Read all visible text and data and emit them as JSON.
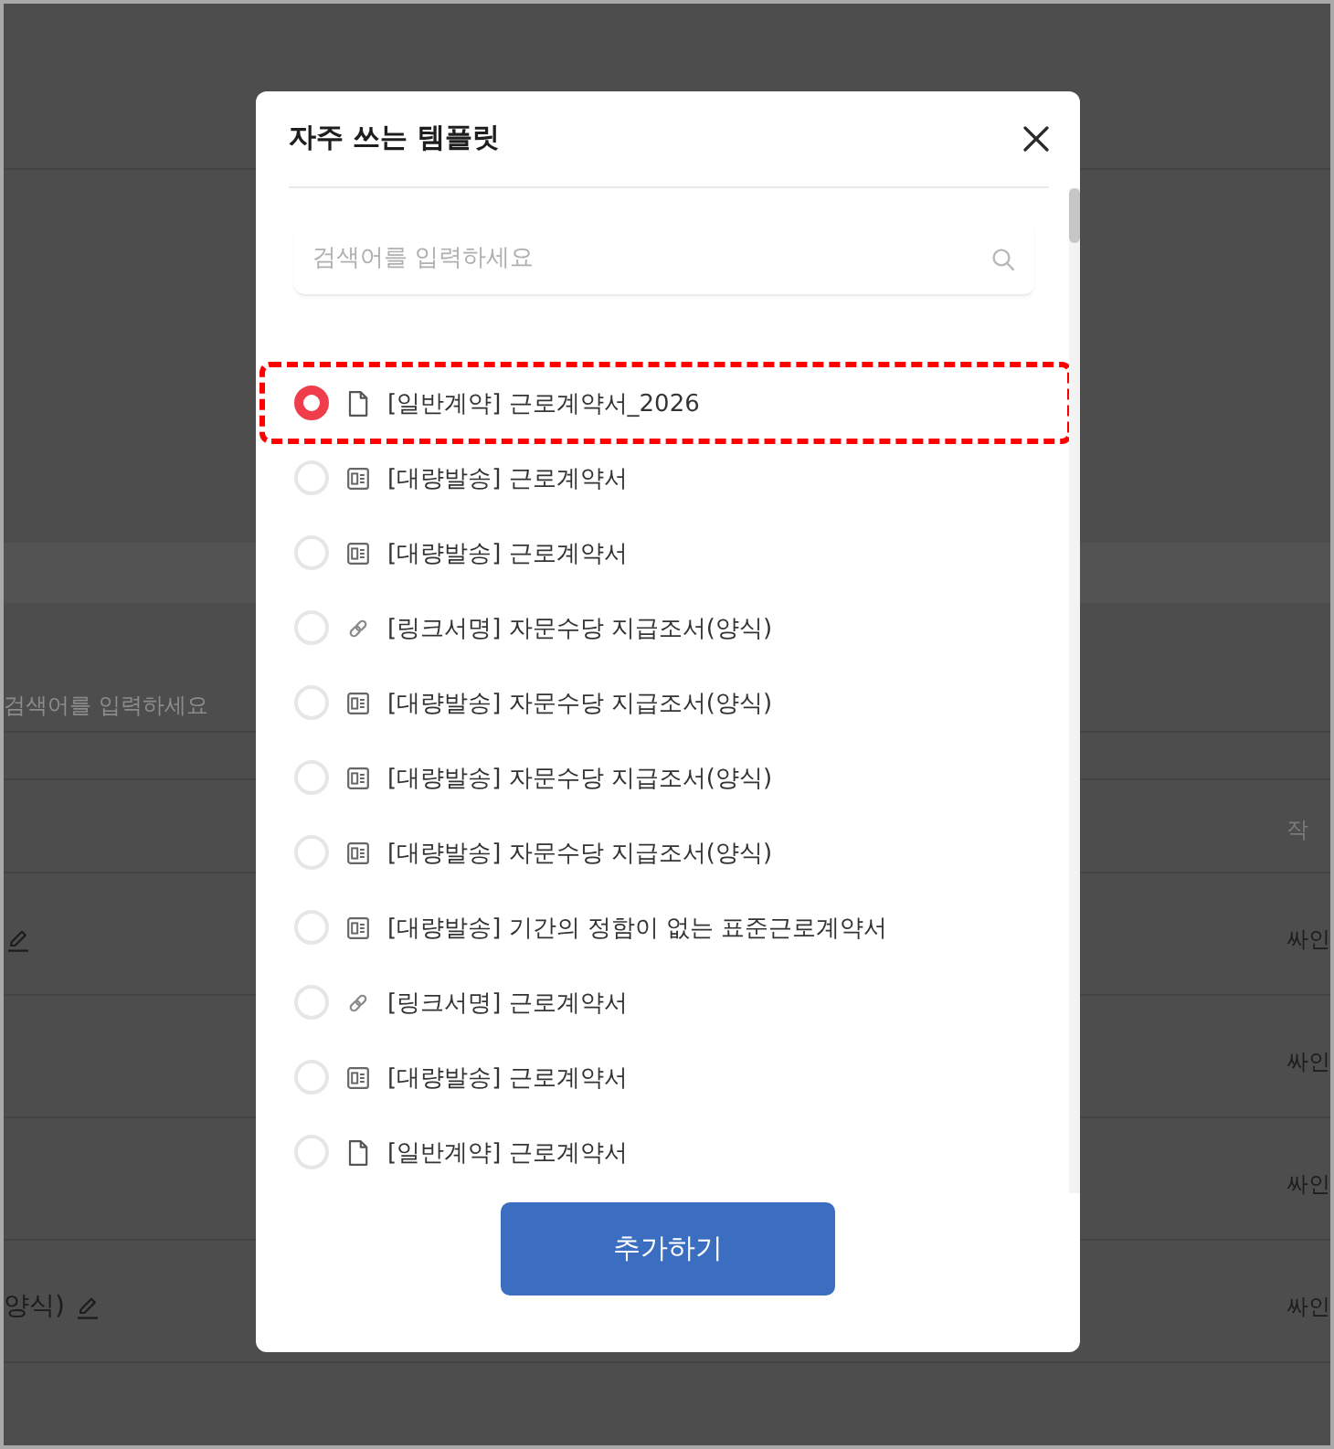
{
  "background": {
    "search_placeholder": "검색어를 입력하세요",
    "column_last_header": "작",
    "rows": [
      {
        "edit_icon": true,
        "column_last": "싸인"
      },
      {
        "edit_icon": false,
        "column_last": "싸인"
      },
      {
        "edit_icon": false,
        "column_last": "싸인"
      },
      {
        "column_1": "양식)",
        "edit_icon": true,
        "column_last": "싸인"
      }
    ]
  },
  "modal": {
    "title": "자주 쓰는 템플릿",
    "search": {
      "placeholder": "검색어를 입력하세요"
    },
    "templates": [
      {
        "kind": "document",
        "label": "[일반계약] 근로계약서_2026",
        "selected": true,
        "highlighted": true
      },
      {
        "kind": "bulk",
        "label": "[대량발송] 근로계약서",
        "selected": false,
        "highlighted": false
      },
      {
        "kind": "bulk",
        "label": "[대량발송] 근로계약서",
        "selected": false,
        "highlighted": false
      },
      {
        "kind": "link",
        "label": "[링크서명] 자문수당 지급조서(양식)",
        "selected": false,
        "highlighted": false
      },
      {
        "kind": "bulk",
        "label": "[대량발송] 자문수당 지급조서(양식)",
        "selected": false,
        "highlighted": false
      },
      {
        "kind": "bulk",
        "label": "[대량발송] 자문수당 지급조서(양식)",
        "selected": false,
        "highlighted": false
      },
      {
        "kind": "bulk",
        "label": "[대량발송] 자문수당 지급조서(양식)",
        "selected": false,
        "highlighted": false
      },
      {
        "kind": "bulk",
        "label": "[대량발송] 기간의 정함이 없는 표준근로계약서",
        "selected": false,
        "highlighted": false
      },
      {
        "kind": "link",
        "label": "[링크서명] 근로계약서",
        "selected": false,
        "highlighted": false
      },
      {
        "kind": "bulk",
        "label": "[대량발송] 근로계약서",
        "selected": false,
        "highlighted": false
      },
      {
        "kind": "document",
        "label": "[일반계약] 근로계약서",
        "selected": false,
        "highlighted": false
      }
    ],
    "submit_button": "추가하기"
  }
}
